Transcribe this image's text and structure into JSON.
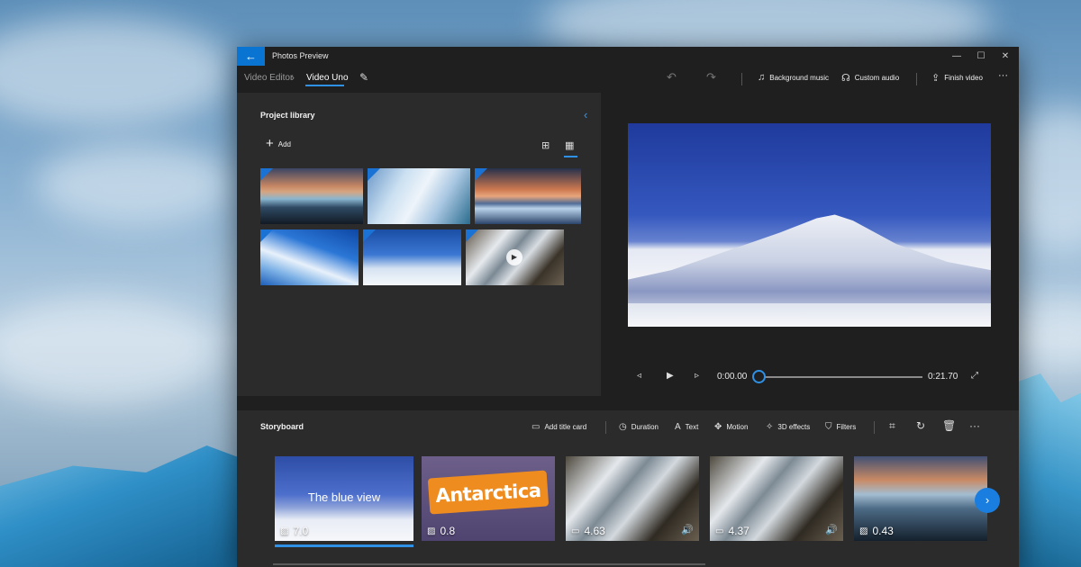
{
  "window": {
    "app_title": "Photos Preview",
    "back_icon": "←",
    "minimize": "—",
    "maximize": "☐",
    "close": "✕"
  },
  "toolbar": {
    "breadcrumb_root": "Video Editor",
    "breadcrumb_current": "Video Uno",
    "background_music_label": "Background music",
    "custom_audio_label": "Custom audio",
    "finish_video_label": "Finish video",
    "more": "···"
  },
  "library": {
    "title": "Project library",
    "add_label": "Add",
    "thumbnails": [
      {
        "kind": "photo"
      },
      {
        "kind": "photo"
      },
      {
        "kind": "photo"
      },
      {
        "kind": "photo"
      },
      {
        "kind": "photo"
      },
      {
        "kind": "video"
      }
    ]
  },
  "player": {
    "current_time": "0:00.00",
    "total_time": "0:21.70",
    "progress": 0.0
  },
  "storyboard": {
    "title": "Storyboard",
    "add_title_card_label": "Add title card",
    "duration_label": "Duration",
    "text_label": "Text",
    "motion_label": "Motion",
    "effects_3d_label": "3D effects",
    "filters_label": "Filters",
    "more": "···",
    "cards": [
      {
        "overlay_text": "The blue view",
        "duration": "7.0",
        "kind": "image",
        "selected": true
      },
      {
        "overlay_text": "Antarctica",
        "duration": "0.8",
        "kind": "image",
        "selected": false
      },
      {
        "overlay_text": "",
        "duration": "4.63",
        "kind": "video",
        "selected": false
      },
      {
        "overlay_text": "",
        "duration": "4.37",
        "kind": "video",
        "selected": false
      },
      {
        "overlay_text": "",
        "duration": "0.43",
        "kind": "image",
        "selected": false
      }
    ]
  },
  "colors": {
    "accent": "#0a74d3",
    "panel": "#2b2b2b",
    "background": "#1f1f1f"
  }
}
